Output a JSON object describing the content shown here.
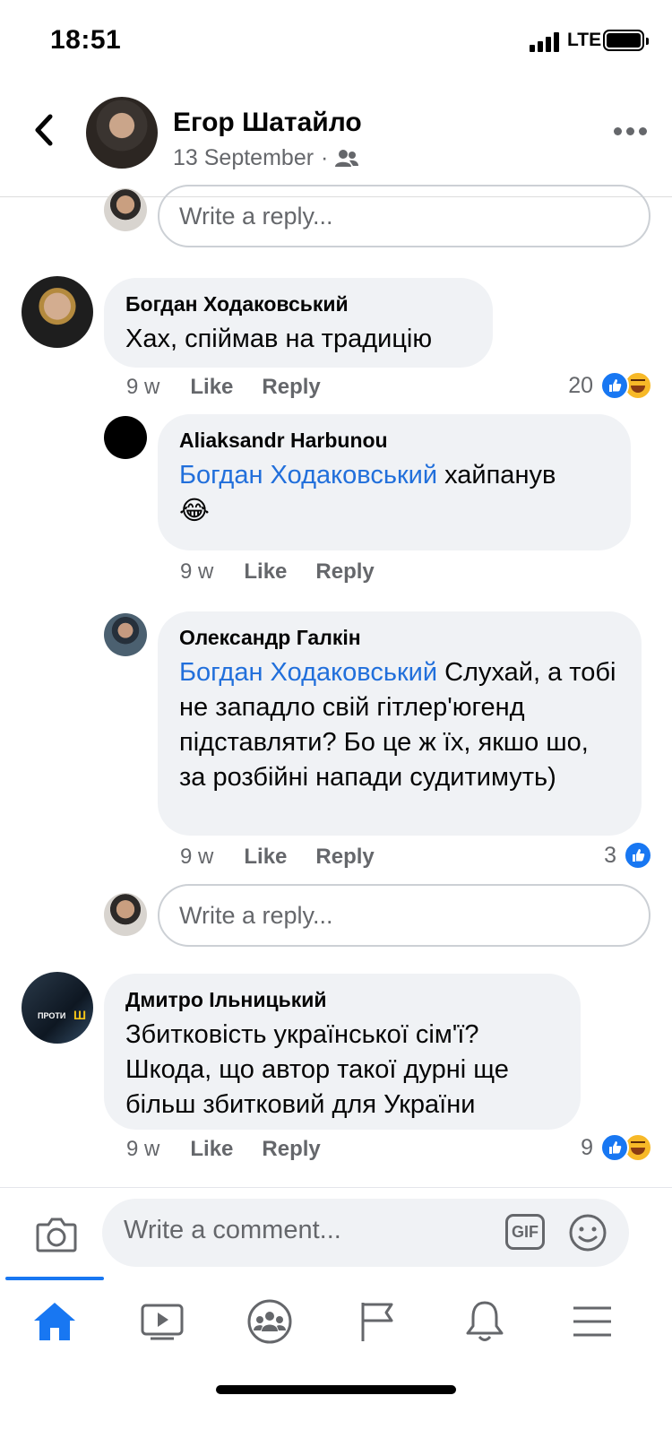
{
  "status_bar": {
    "time": "18:51",
    "network": "LTE"
  },
  "header": {
    "name": "Егор Шатайло",
    "date": "13 September",
    "separator": "·"
  },
  "reply_placeholder": "Write a reply...",
  "comments": [
    {
      "author": "Богдан Ходаковський",
      "text": "Хах, спіймав на традицію",
      "time": "9 w",
      "like_label": "Like",
      "reply_label": "Reply",
      "reaction_count": "20"
    },
    {
      "author": "Aliaksandr Harbunou",
      "mention": "Богдан Ходаковський",
      "text": " хайпанув",
      "emoji": "😂",
      "time": "9 w",
      "like_label": "Like",
      "reply_label": "Reply"
    },
    {
      "author": "Олександр Галкін",
      "mention": "Богдан Ходаковський",
      "text": " Слухай, а тобі не западло свій гітлер'югенд підставляти? Бо це ж їх, якшо шо, за розбійні напади судитимуть)",
      "time": "9 w",
      "like_label": "Like",
      "reply_label": "Reply",
      "reaction_count": "3"
    },
    {
      "author": "Дмитро Ільницький",
      "text": "Збитковість української сім'ї? Шкода, що автор такої дурні ще більш збитковий для України",
      "time": "9 w",
      "like_label": "Like",
      "reply_label": "Reply",
      "reaction_count": "9",
      "avatar_text": "ПРОТИ"
    }
  ],
  "composer": {
    "placeholder": "Write a comment...",
    "gif_label": "GIF"
  },
  "nav": [
    "home-icon",
    "watch-icon",
    "groups-icon",
    "pages-icon",
    "notifications-icon",
    "menu-icon"
  ],
  "colors": {
    "accent": "#1877f2",
    "mention": "#216fdb",
    "haha": "#f7b928",
    "bubble": "#f0f2f5"
  }
}
